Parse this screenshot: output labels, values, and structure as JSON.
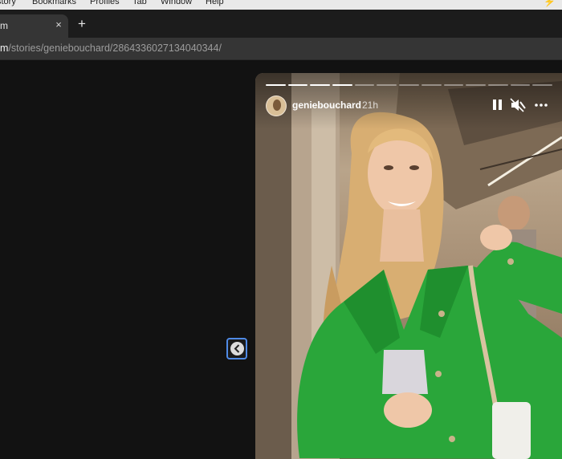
{
  "menubar": {
    "items": [
      "story",
      "Bookmarks",
      "Profiles",
      "Tab",
      "Window",
      "Help"
    ]
  },
  "tab": {
    "title": "m",
    "close_glyph": "×"
  },
  "new_tab_glyph": "+",
  "address": {
    "host": "m",
    "path": "/stories/geniebouchard/2864336027134040344/"
  },
  "story": {
    "username": "geniebouchard",
    "time": "21h",
    "segments_total": 13,
    "segments_done": 4,
    "colors": {
      "jacket": "#2aa63a",
      "hair": "#d9b27a",
      "background": "#a48c72"
    }
  },
  "icons": [
    "chevron-left-icon",
    "pause-icon",
    "mute-icon",
    "more-icon"
  ]
}
